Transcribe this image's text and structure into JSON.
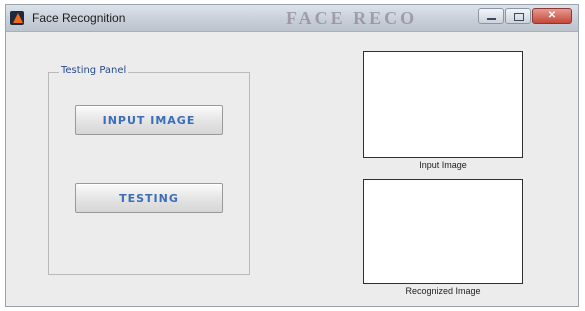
{
  "window": {
    "title": "Face Recognition",
    "watermark": "FACE RECO"
  },
  "testing_panel": {
    "title": "Testing Panel",
    "input_image_button": "INPUT IMAGE",
    "testing_button": "TESTING"
  },
  "axes": {
    "input_label": "Input Image",
    "recognized_label": "Recognized Image"
  },
  "icons": {
    "app": "matlab-icon",
    "minimize": "minimize-icon",
    "maximize": "maximize-icon",
    "close": "close-icon"
  },
  "colors": {
    "button_text": "#3b6db8",
    "panel_title": "#2a4a8a",
    "window_bg": "#ececec",
    "close_button": "#c4473a"
  }
}
